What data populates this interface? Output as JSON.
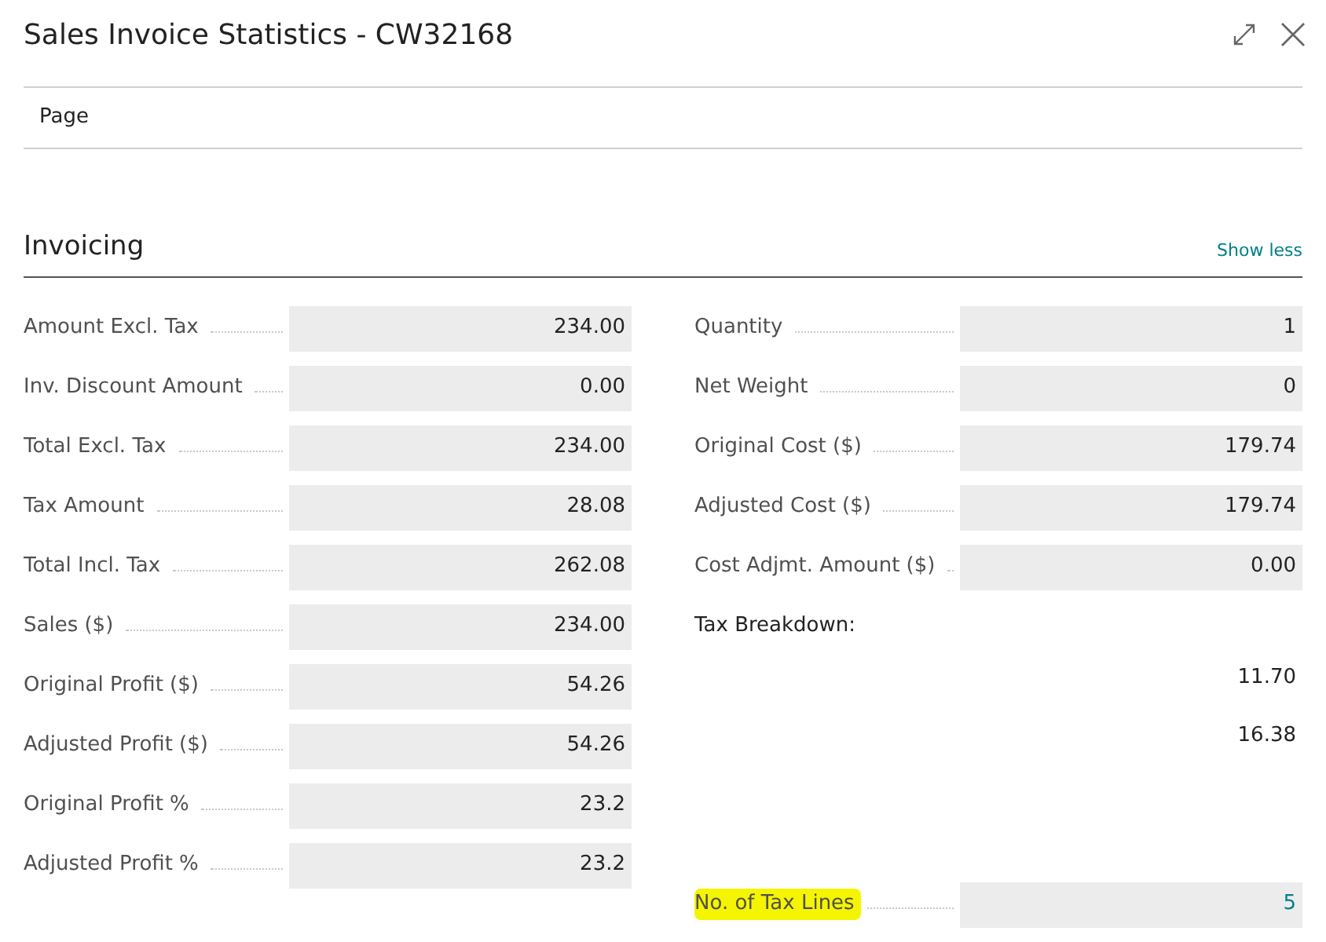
{
  "window": {
    "title": "Sales Invoice Statistics - CW32168"
  },
  "action_bar": {
    "items": [
      "Page"
    ]
  },
  "section": {
    "title": "Invoicing",
    "toggle": "Show less"
  },
  "left_fields": [
    {
      "label": "Amount Excl. Tax",
      "value": "234.00"
    },
    {
      "label": "Inv. Discount Amount",
      "value": "0.00"
    },
    {
      "label": "Total Excl. Tax",
      "value": "234.00"
    },
    {
      "label": "Tax Amount",
      "value": "28.08"
    },
    {
      "label": "Total Incl. Tax",
      "value": "262.08"
    },
    {
      "label": "Sales ($)",
      "value": "234.00"
    },
    {
      "label": "Original Profit ($)",
      "value": "54.26"
    },
    {
      "label": "Adjusted Profit ($)",
      "value": "54.26"
    },
    {
      "label": "Original Profit %",
      "value": "23.2"
    },
    {
      "label": "Adjusted Profit %",
      "value": "23.2"
    }
  ],
  "right_fields": [
    {
      "kind": "field",
      "label": "Quantity",
      "value": "1",
      "drilldown": false,
      "highlighted": false
    },
    {
      "kind": "field",
      "label": "Net Weight",
      "value": "0",
      "drilldown": false,
      "highlighted": false
    },
    {
      "kind": "field",
      "label": "Original Cost ($)",
      "value": "179.74",
      "drilldown": false,
      "highlighted": false
    },
    {
      "kind": "field",
      "label": "Adjusted Cost ($)",
      "value": "179.74",
      "drilldown": false,
      "highlighted": false
    },
    {
      "kind": "field",
      "label": "Cost Adjmt. Amount ($)",
      "value": "0.00",
      "drilldown": false,
      "highlighted": false
    },
    {
      "kind": "heading",
      "label": "Tax Breakdown:"
    },
    {
      "kind": "amount",
      "value": "11.70"
    },
    {
      "kind": "amount",
      "value": "16.38"
    },
    {
      "kind": "field",
      "label": "No. of Tax Lines",
      "value": "5",
      "drilldown": true,
      "highlighted": true
    }
  ]
}
